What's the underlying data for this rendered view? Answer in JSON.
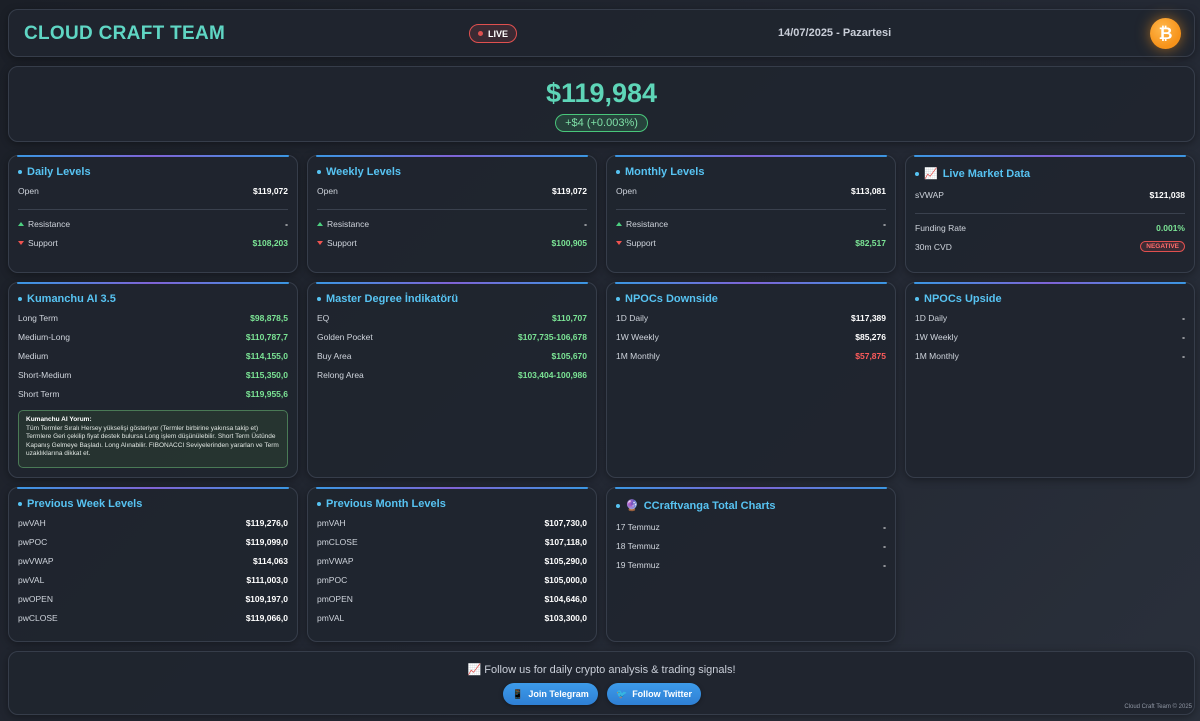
{
  "header": {
    "brand": "CLOUD CRAFT TEAM",
    "live_label": "LIVE",
    "date": "14/07/2025 - Pazartesi",
    "coin_glyph": "₿",
    "accent_color": "#5fd6c4"
  },
  "price": {
    "value": "$119,984",
    "change": "+$4 (+0.003%)"
  },
  "daily": {
    "title": "Daily Levels",
    "open_label": "Open",
    "open_value": "$119,072",
    "resistance_label": "Resistance",
    "resistance_value": "-",
    "support_label": "Support",
    "support_value": "$108,203"
  },
  "weekly": {
    "title": "Weekly Levels",
    "open_label": "Open",
    "open_value": "$119,072",
    "resistance_label": "Resistance",
    "resistance_value": "-",
    "support_label": "Support",
    "support_value": "$100,905"
  },
  "monthly": {
    "title": "Monthly Levels",
    "open_label": "Open",
    "open_value": "$113,081",
    "resistance_label": "Resistance",
    "resistance_value": "-",
    "support_label": "Support",
    "support_value": "$82,517"
  },
  "live_market": {
    "icon": "📈",
    "title": "Live Market Data",
    "svwap_label": "sVWAP",
    "svwap_value": "$121,038",
    "funding_label": "Funding Rate",
    "funding_value": "0.001%",
    "cvd_label": "30m CVD",
    "cvd_value": "NEGATIVE"
  },
  "kumanchu": {
    "title": "Kumanchu AI 3.5",
    "rows": [
      {
        "label": "Long Term",
        "value": "$98,878,5"
      },
      {
        "label": "Medium-Long",
        "value": "$110,787,7"
      },
      {
        "label": "Medium",
        "value": "$114,155,0"
      },
      {
        "label": "Short-Medium",
        "value": "$115,350,0"
      },
      {
        "label": "Short Term",
        "value": "$119,955,6"
      }
    ],
    "comment_title": "Kumanchu AI Yorum:",
    "comment_text": "Tüm Termler Sıralı Hersey yükselişi gösteriyor (Termler birbirine yakınsa takip et) Termlere Geri çekilip fiyat destek bulursa Long işlem düşünülebilir. Short Term Üstünde Kapanış Gelmeye Başladı. Long Alınabilir. FIBONACCI Seviyelerinden yararlan ve Term uzaklıklarına dikkat et."
  },
  "master": {
    "title": "Master Degree İndikatörü",
    "rows": [
      {
        "label": "EQ",
        "value": "$110,707"
      },
      {
        "label": "Golden Pocket",
        "value": "$107,735-106,678"
      },
      {
        "label": "Buy Area",
        "value": "$105,670"
      },
      {
        "label": "Relong Area",
        "value": "$103,404-100,986"
      }
    ]
  },
  "npocs_down": {
    "title": "NPOCs Downside",
    "rows": [
      {
        "label": "1D Daily",
        "value": "$117,389"
      },
      {
        "label": "1W Weekly",
        "value": "$85,276"
      },
      {
        "label": "1M Monthly",
        "value": "$57,875"
      }
    ]
  },
  "npocs_up": {
    "title": "NPOCs Upside",
    "rows": [
      {
        "label": "1D Daily",
        "value": "-"
      },
      {
        "label": "1W Weekly",
        "value": "-"
      },
      {
        "label": "1M Monthly",
        "value": "-"
      }
    ]
  },
  "prev_week": {
    "title": "Previous Week Levels",
    "rows": [
      {
        "label": "pwVAH",
        "value": "$119,276,0"
      },
      {
        "label": "pwPOC",
        "value": "$119,099,0"
      },
      {
        "label": "pwVWAP",
        "value": "$114,063"
      },
      {
        "label": "pwVAL",
        "value": "$111,003,0"
      },
      {
        "label": "pwOPEN",
        "value": "$109,197,0"
      },
      {
        "label": "pwCLOSE",
        "value": "$119,066,0"
      }
    ]
  },
  "prev_month": {
    "title": "Previous Month Levels",
    "rows": [
      {
        "label": "pmVAH",
        "value": "$107,730,0"
      },
      {
        "label": "pmCLOSE",
        "value": "$107,118,0"
      },
      {
        "label": "pmVWAP",
        "value": "$105,290,0"
      },
      {
        "label": "pmPOC",
        "value": "$105,000,0"
      },
      {
        "label": "pmOPEN",
        "value": "$104,646,0"
      },
      {
        "label": "pmVAL",
        "value": "$103,300,0"
      }
    ]
  },
  "ccraft": {
    "icon": "🔮",
    "title": "CCraftvanga Total Charts",
    "rows": [
      {
        "label": "17 Temmuz",
        "value": "-"
      },
      {
        "label": "18 Temmuz",
        "value": "-"
      },
      {
        "label": "19 Temmuz",
        "value": "-"
      }
    ]
  },
  "footer": {
    "follow_icon": "📈",
    "follow_text": "Follow us for daily crypto analysis & trading signals!",
    "telegram_icon": "📱",
    "telegram_label": "Join Telegram",
    "twitter_icon": "🐦",
    "twitter_label": "Follow Twitter",
    "copyright": "Cloud Craft Team © 2025"
  }
}
